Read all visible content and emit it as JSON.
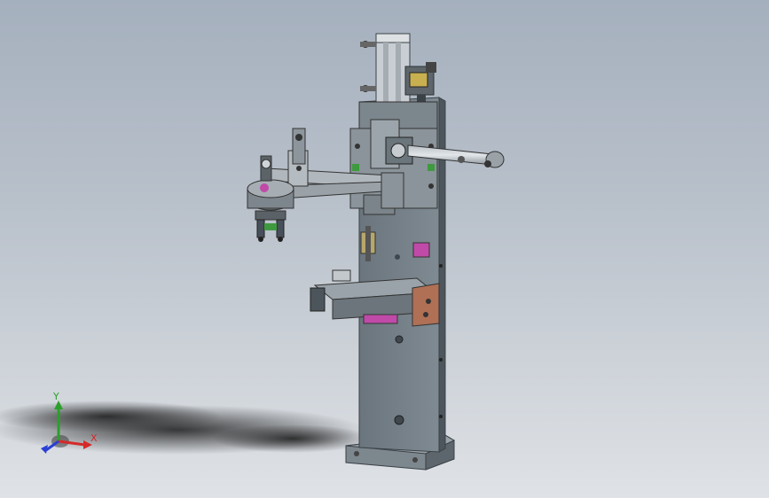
{
  "viewport": {
    "background_top": "#a5b0be",
    "background_bottom": "#dfe2e6"
  },
  "triad": {
    "x_label": "X",
    "y_label": "Y",
    "x_color": "#d42a2a",
    "y_color": "#2aa02a",
    "z_color": "#2a3fd4"
  },
  "model": {
    "plate_color": "#6f7a82",
    "accent_pink": "#c04aa8",
    "accent_copper": "#b07055",
    "accent_green": "#3f9a3f",
    "accent_yellow": "#c8b050"
  }
}
